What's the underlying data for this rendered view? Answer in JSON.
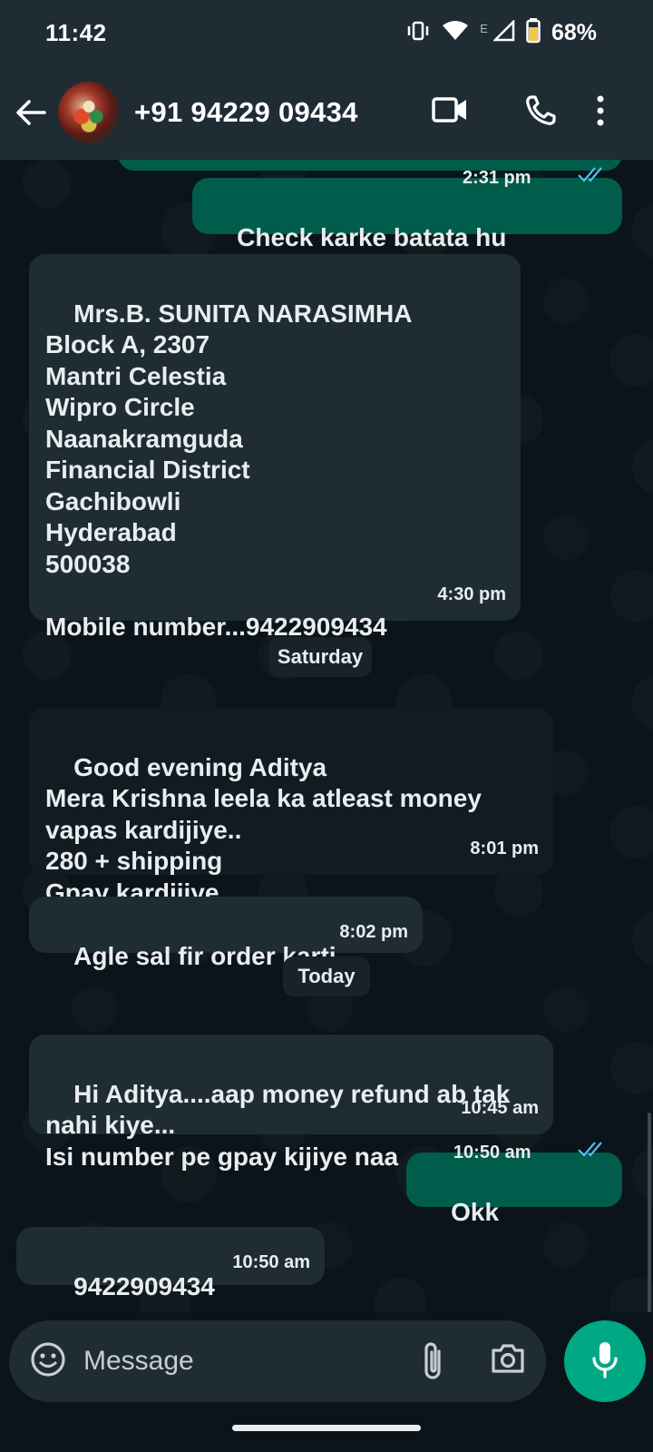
{
  "status_bar": {
    "time": "11:42",
    "network_label": "E",
    "battery": "68%",
    "icons": [
      "vibrate-icon",
      "wifi-icon",
      "signal-icon",
      "battery-icon"
    ]
  },
  "header": {
    "contact": "+91 94229 09434",
    "icons": [
      "back-arrow-icon",
      "avatar",
      "video-call-icon",
      "voice-call-icon",
      "more-vert-icon"
    ]
  },
  "messages": [
    {
      "dir": "out",
      "text": "Check karke batata hu",
      "time": "2:31 pm",
      "read": true
    },
    {
      "dir": "in",
      "text": "Mrs.B. SUNITA NARASIMHA\nBlock A, 2307\nMantri Celestia\nWipro Circle\nNaanakramguda\nFinancial District\nGachibowli\nHyderabad\n500038\n\nMobile number...9422909434",
      "time": "4:30 pm"
    },
    {
      "dir": "in",
      "text": "Good evening Aditya\nMera Krishna leela ka atleast money\nvapas kardijiye..\n280 + shipping\nGpay kardijiye",
      "time": "8:01 pm"
    },
    {
      "dir": "in",
      "text": "Agle sal fir order karti",
      "time": "8:02 pm"
    },
    {
      "dir": "in",
      "text": "Hi Aditya....aap money refund ab tak\nnahi kiye...\nIsi number pe gpay kijiye naa",
      "time": "10:45 am"
    },
    {
      "dir": "out",
      "text": "Okk",
      "time": "10:50 am",
      "read": true
    },
    {
      "dir": "in",
      "text": "9422909434",
      "time": "10:50 am"
    }
  ],
  "day_separators": {
    "saturday": "Saturday",
    "today": "Today"
  },
  "composer": {
    "placeholder": "Message"
  },
  "colors": {
    "incoming_bubble": "#1f2c34",
    "outgoing_bubble": "#005c4b",
    "accent": "#00a884",
    "read_ticks": "#53bdeb"
  }
}
